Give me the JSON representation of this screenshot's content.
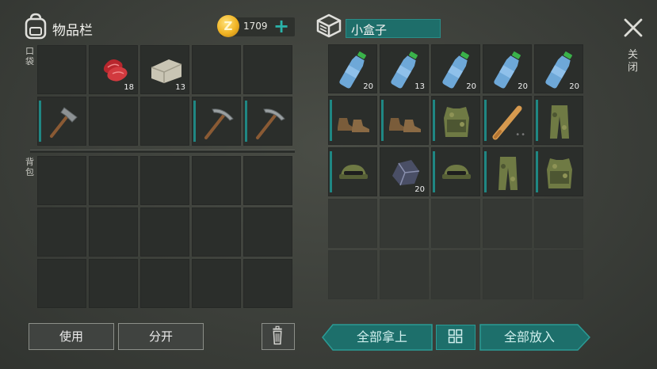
{
  "inventory": {
    "title": "物品栏",
    "coins": "1709",
    "coin_symbol": "Z",
    "plus": "+",
    "pocket_label": "口袋",
    "backpack_label": "背包"
  },
  "container": {
    "title": "小盒子",
    "close_label": "关闭"
  },
  "pockets": [
    {
      "item": "",
      "qty": ""
    },
    {
      "item": "raw-meat-icon",
      "qty": "18"
    },
    {
      "item": "stone-block-icon",
      "qty": "13"
    },
    {
      "item": "",
      "qty": ""
    },
    {
      "item": "",
      "qty": ""
    },
    {
      "item": "hatchet-icon",
      "qty": "",
      "marked": true
    },
    {
      "item": "",
      "qty": ""
    },
    {
      "item": "",
      "qty": ""
    },
    {
      "item": "pickaxe-icon",
      "qty": "",
      "marked": true
    },
    {
      "item": "pickaxe-icon",
      "qty": "",
      "marked": true
    }
  ],
  "box_items": [
    {
      "item": "water-bottle-icon",
      "qty": "20"
    },
    {
      "item": "water-bottle-icon",
      "qty": "13"
    },
    {
      "item": "water-bottle-icon",
      "qty": "20"
    },
    {
      "item": "water-bottle-icon",
      "qty": "20"
    },
    {
      "item": "water-bottle-icon",
      "qty": "20"
    },
    {
      "item": "boots-icon",
      "qty": "",
      "marked": true
    },
    {
      "item": "boots-icon",
      "qty": "",
      "marked": true
    },
    {
      "item": "camo-vest-icon",
      "qty": "",
      "marked": true
    },
    {
      "item": "baseball-bat-icon",
      "qty": "",
      "marked": true,
      "dots": true
    },
    {
      "item": "camo-pants-icon",
      "qty": "",
      "marked": true
    },
    {
      "item": "camo-cap-icon",
      "qty": "",
      "marked": true
    },
    {
      "item": "iron-ore-icon",
      "qty": "20"
    },
    {
      "item": "camo-cap-icon",
      "qty": "",
      "marked": true
    },
    {
      "item": "camo-pants-icon",
      "qty": "",
      "marked": true
    },
    {
      "item": "camo-vest-icon",
      "qty": "",
      "marked": true
    }
  ],
  "buttons": {
    "use": "使用",
    "split": "分开",
    "take_all": "全部拿上",
    "put_all": "全部放入",
    "layout_icon": "grid-icon",
    "trash_icon": "trash-icon"
  },
  "colors": {
    "teal": "#1f8783",
    "coin": "#f0b323"
  }
}
